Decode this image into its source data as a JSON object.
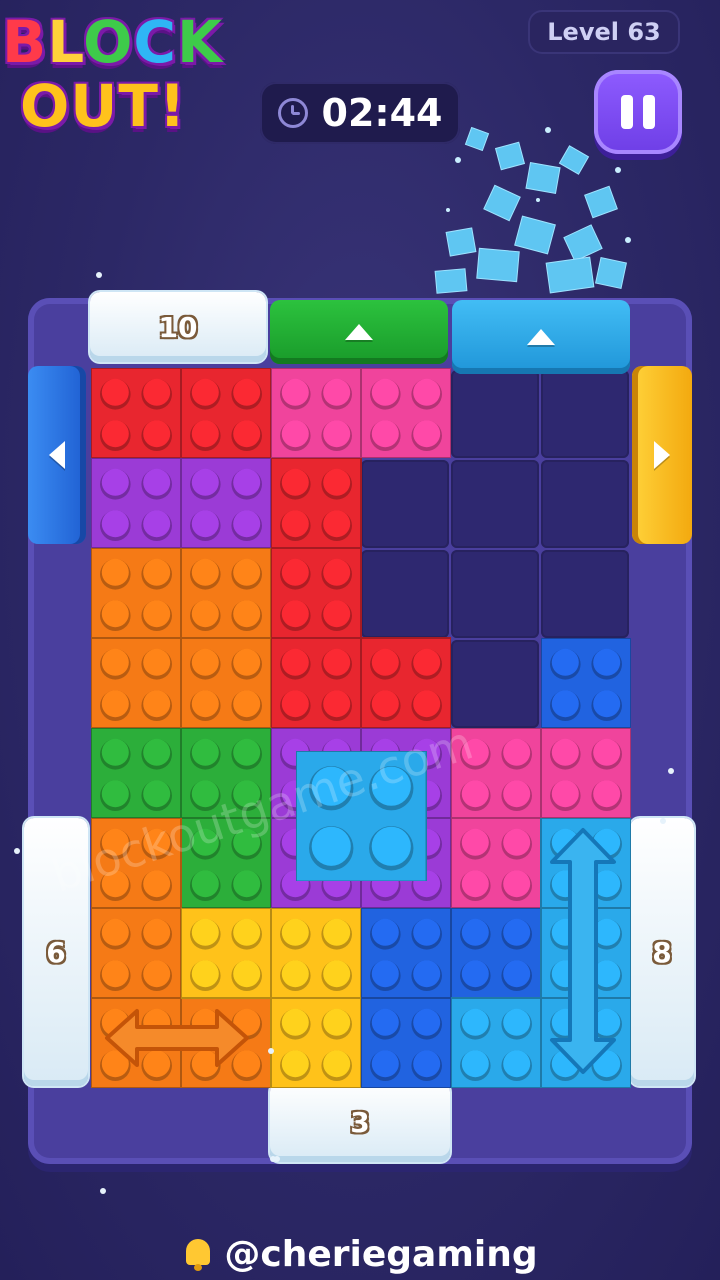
{
  "header": {
    "logo_line1": "BLOCK",
    "logo_line2": "OUT!",
    "level_label": "Level 63",
    "timer": "02:44"
  },
  "gates": {
    "top_left_count": "10",
    "left_count": "6",
    "right_count": "8",
    "bottom_count": "3"
  },
  "watermark": "blockoutgame.com",
  "credit": "@cheriegaming",
  "colors": {
    "red": "#e8262f",
    "pink": "#f0449c",
    "purple": "#9b3bd6",
    "orange": "#f57a16",
    "green": "#2cae3a",
    "blue": "#2163e0",
    "yellow": "#ffc21a",
    "cyan": "#2aa9ea",
    "gate_blue": "#2a7ae8",
    "gate_yellow": "#ffbf1a",
    "gate_green": "#1fae33",
    "gate_cyan": "#2aa9ea"
  },
  "icons": [
    "clock-icon",
    "pause-icon",
    "bell-icon",
    "arrow-up-icon",
    "arrow-left-icon",
    "arrow-right-icon",
    "horizontal-double-arrow-icon",
    "vertical-double-arrow-icon"
  ]
}
